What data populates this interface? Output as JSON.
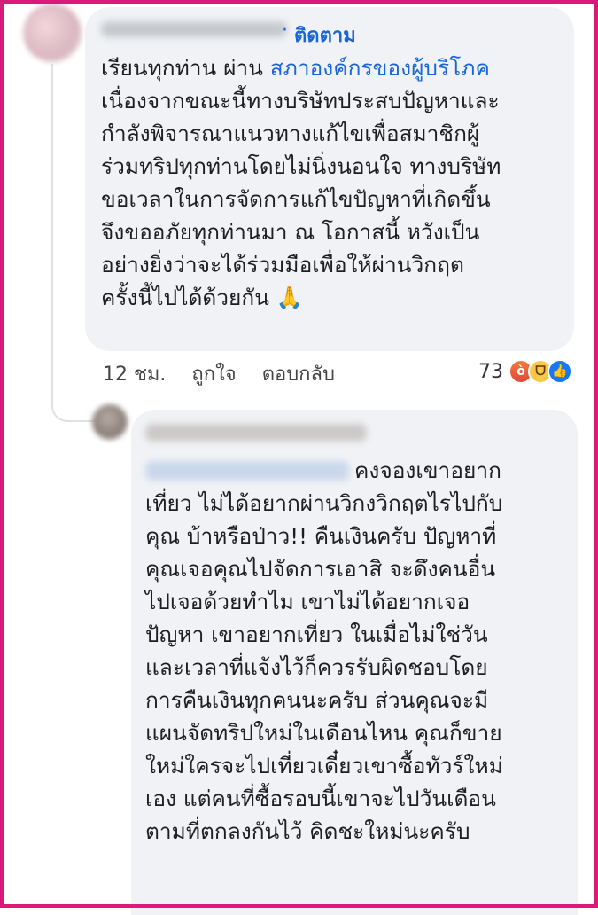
{
  "comment1": {
    "follow_label": "ติดตาม",
    "lines": [
      {
        "prefix": "เรียนทุกท่าน ผ่าน ",
        "link": "สภาองค์กรของผู้บริโภค"
      },
      "เนื่องจากขณะนี้ทางบริษัทประสบปัญหาและ",
      "กำลังพิจารณาแนวทางแก้ไขเพื่อสมาชิกผู้",
      "ร่วมทริปทุกท่านโดยไม่นิ่งนอนใจ ทางบริษัท",
      "ขอเวลาในการจัดการแก้ไขปัญหาที่เกิดขึ้น",
      "จึงขออภัยทุกท่านมา ณ โอกาสนี้ หวังเป็น",
      "อย่างยิ่งว่าจะได้ร่วมมือเพื่อให้ผ่านวิกฤต",
      "ครั้งนี้ไปได้ด้วยกัน 🙏"
    ],
    "time": "12 ชม.",
    "like_label": "ถูกใจ",
    "reply_label": "ตอบกลับ",
    "reaction_count": "73",
    "reaction_icons": [
      "angry-icon",
      "haha-icon",
      "like-icon"
    ]
  },
  "comment2": {
    "lines": [
      "คงจองเขาอยาก",
      "เที่ยว ไม่ได้อยากผ่านวิกงวิกฤตไรไปกับ",
      "คุณ บ้าหรือป่าว!! คืนเงินครับ ปัญหาที่",
      "คุณเจอคุณไปจัดการเอาสิ จะดึงคนอื่น",
      "ไปเจอด้วยทำไม เขาไม่ได้อยากเจอ",
      "ปัญหา เขาอยากเที่ยว ในเมื่อไม่ใช่วัน",
      "และเวลาที่แจ้งไว้ก็ควรรับผิดชอบโดย",
      "การคืนเงินทุกคนนะครับ ส่วนคุณจะมี",
      "แผนจัดทริปใหม่ในเดือนไหน คุณก็ขาย",
      "ใหม่ใครจะไปเที่ยวเดี๋ยวเขาซื้อทัวร์ใหม่",
      "เอง แต่คนที่ซื้อรอบนี้เขาจะไปวันเดือน",
      "ตามที่ตกลงกันไว้ คิดชะใหม่นะครับ"
    ]
  },
  "colors": {
    "frame": "#d81b7a",
    "link": "#1b66d6",
    "bubble": "#f0f2f5"
  }
}
